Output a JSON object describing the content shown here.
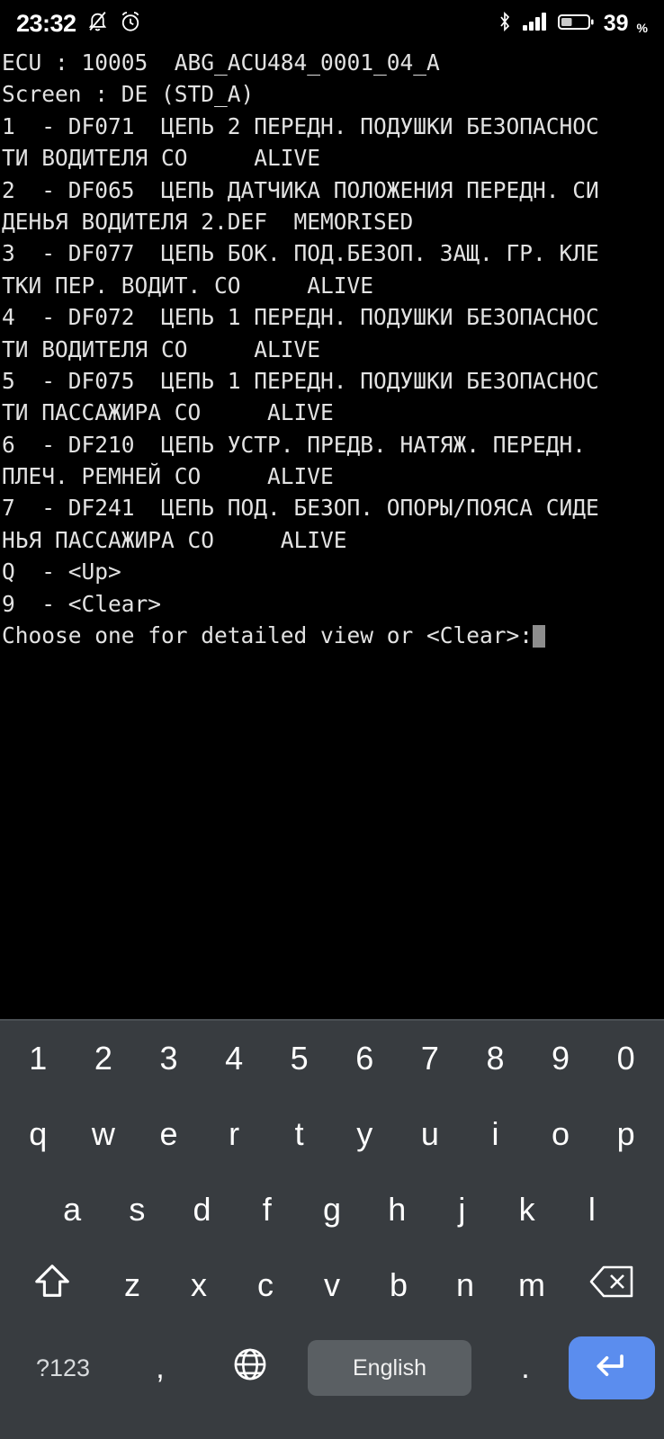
{
  "status_bar": {
    "time": "23:32",
    "icons_left": [
      "bell-mute-icon",
      "alarm-clock-icon"
    ],
    "icons_right": [
      "bluetooth-icon",
      "signal-bars-icon",
      "battery-icon"
    ],
    "battery_percent": "39",
    "percent_sign": "%",
    "battery_level": 39,
    "text_color": "#ffffff",
    "background": "#000000"
  },
  "terminal": {
    "background": "#000000",
    "text_color": "#e2e2e2",
    "cursor_color": "#8d8d8d",
    "header": {
      "ecu_line": "ECU : 10005  ABG_ACU484_0001_04_A",
      "screen_line": "Screen : DE (STD_A)"
    },
    "lines": [
      "ECU : 10005  ABG_ACU484_0001_04_A",
      "Screen : DE (STD_A)",
      "1  - DF071  ЦЕПЬ 2 ПЕРЕДН. ПОДУШКИ БЕЗОПАСНОС",
      "ТИ ВОДИТЕЛЯ СО     ALIVE",
      "2  - DF065  ЦЕПЬ ДАТЧИКА ПОЛОЖЕНИЯ ПЕРЕДН. СИ",
      "ДЕНЬЯ ВОДИТЕЛЯ 2.DEF  MEMORISED",
      "3  - DF077  ЦЕПЬ БОК. ПОД.БЕЗОП. ЗАЩ. ГР. КЛЕ",
      "ТКИ ПЕР. ВОДИТ. СО     ALIVE",
      "4  - DF072  ЦЕПЬ 1 ПЕРЕДН. ПОДУШКИ БЕЗОПАСНОС",
      "ТИ ВОДИТЕЛЯ СО     ALIVE",
      "5  - DF075  ЦЕПЬ 1 ПЕРЕДН. ПОДУШКИ БЕЗОПАСНОС",
      "ТИ ПАССАЖИРА СО     ALIVE",
      "6  - DF210  ЦЕПЬ УСТР. ПРЕДВ. НАТЯЖ. ПЕРЕДН.",
      "ПЛЕЧ. РЕМНЕЙ СО     ALIVE",
      "7  - DF241  ЦЕПЬ ПОД. БЕЗОП. ОПОРЫ/ПОЯСА СИДЕ",
      "НЬЯ ПАССАЖИРА СО     ALIVE",
      "Q  - <Up>",
      "9  - <Clear>"
    ],
    "fault_entries": [
      {
        "index": "1",
        "code": "DF071",
        "description": "ЦЕПЬ 2 ПЕРЕДН. ПОДУШКИ БЕЗОПАСНОСТИ ВОДИТЕЛЯ СО",
        "status": "ALIVE"
      },
      {
        "index": "2",
        "code": "DF065",
        "description": "ЦЕПЬ ДАТЧИКА ПОЛОЖЕНИЯ ПЕРЕДН. СИДЕНЬЯ ВОДИТЕЛЯ 2.DEF",
        "status": "MEMORISED"
      },
      {
        "index": "3",
        "code": "DF077",
        "description": "ЦЕПЬ БОК. ПОД.БЕЗОП. ЗАЩ. ГР. КЛЕТКИ ПЕР. ВОДИТ. СО",
        "status": "ALIVE"
      },
      {
        "index": "4",
        "code": "DF072",
        "description": "ЦЕПЬ 1 ПЕРЕДН. ПОДУШКИ БЕЗОПАСНОСТИ ВОДИТЕЛЯ СО",
        "status": "ALIVE"
      },
      {
        "index": "5",
        "code": "DF075",
        "description": "ЦЕПЬ 1 ПЕРЕДН. ПОДУШКИ БЕЗОПАСНОСТИ ПАССАЖИРА СО",
        "status": "ALIVE"
      },
      {
        "index": "6",
        "code": "DF210",
        "description": "ЦЕПЬ УСТР. ПРЕДВ. НАТЯЖ. ПЕРЕДН. ПЛЕЧ. РЕМНЕЙ СО",
        "status": "ALIVE"
      },
      {
        "index": "7",
        "code": "DF241",
        "description": "ЦЕПЬ ПОД. БЕЗОП. ОПОРЫ/ПОЯСА СИДЕНЬЯ ПАССАЖИРА СО",
        "status": "ALIVE"
      }
    ],
    "menu_options": [
      {
        "key": "Q",
        "label": "<Up>"
      },
      {
        "key": "9",
        "label": "<Clear>"
      }
    ],
    "prompt": "Choose one for detailed view or <Clear>:"
  },
  "keyboard": {
    "background": "#383c40",
    "key_text_color": "#ffffff",
    "spacebar_color": "#5a5f63",
    "enter_color": "#5b8dee",
    "row_numbers": [
      "1",
      "2",
      "3",
      "4",
      "5",
      "6",
      "7",
      "8",
      "9",
      "0"
    ],
    "row_top": [
      "q",
      "w",
      "e",
      "r",
      "t",
      "y",
      "u",
      "i",
      "o",
      "p"
    ],
    "row_home": [
      "a",
      "s",
      "d",
      "f",
      "g",
      "h",
      "j",
      "k",
      "l"
    ],
    "row_bottom_letters": [
      "z",
      "x",
      "c",
      "v",
      "b",
      "n",
      "m"
    ],
    "shift_key": "shift-icon",
    "backspace_key": "backspace-icon",
    "symbols_key": "?123",
    "comma_key": ",",
    "globe_key": "globe-icon",
    "space_key_label": "English",
    "period_key": ".",
    "enter_key": "enter-icon"
  }
}
